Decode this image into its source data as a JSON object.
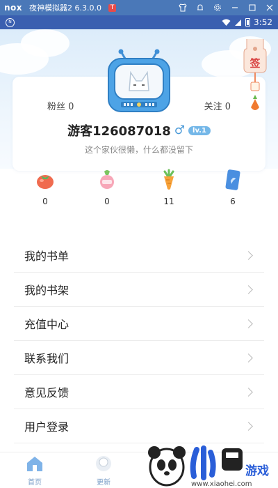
{
  "emulator": {
    "logo": "nox",
    "title": "夜神模拟器2 6.3.0.0",
    "badge": "T"
  },
  "status_bar": {
    "time": "3:52"
  },
  "profile": {
    "fans_label": "粉丝 0",
    "follow_label": "关注 0",
    "username": "游客126087018",
    "gender_symbol": "♂",
    "level": "lv.1",
    "bio": "这个家伙很懒，什么都没留下"
  },
  "sign_in": {
    "label": "签"
  },
  "stats": [
    {
      "icon": "tomato-icon",
      "value": "0"
    },
    {
      "icon": "radish-icon",
      "value": "0"
    },
    {
      "icon": "carrot-icon",
      "value": "11"
    },
    {
      "icon": "card-icon",
      "value": "6"
    }
  ],
  "menu": {
    "items": [
      {
        "label": "我的书单"
      },
      {
        "label": "我的书架"
      },
      {
        "label": "充值中心"
      },
      {
        "label": "联系我们"
      },
      {
        "label": "意见反馈"
      },
      {
        "label": "用户登录"
      }
    ]
  },
  "tabbar": {
    "home_label": "首页",
    "update_label": "更新"
  },
  "watermark": {
    "brand_text": "小黑游戏",
    "url": "www.xiaohei.com"
  },
  "colors": {
    "primary_blue": "#4a9ad8",
    "level_badge": "#74b7e8",
    "emulator_bar": "#4a78b8",
    "status_bar": "#3a5fb0"
  }
}
